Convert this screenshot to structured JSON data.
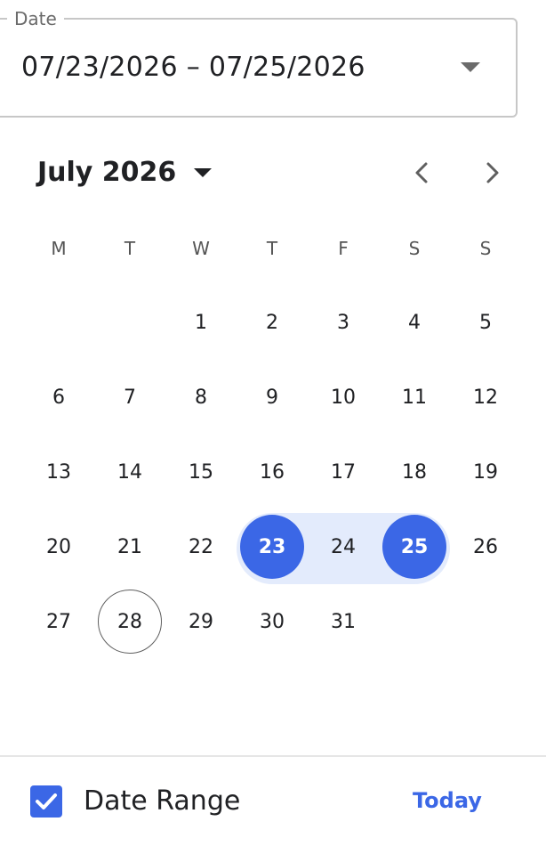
{
  "date_field": {
    "label": "Date",
    "value": "07/23/2026 – 07/25/2026",
    "dropdown_icon": "triangle-down-icon"
  },
  "calendar": {
    "month_title": "July 2026",
    "month_dropdown_icon": "caret-down-icon",
    "prev_icon": "chevron-left-icon",
    "next_icon": "chevron-right-icon",
    "weekdays": [
      "M",
      "T",
      "W",
      "T",
      "F",
      "S",
      "S"
    ],
    "weeks": [
      [
        "",
        "",
        "1",
        "2",
        "3",
        "4",
        "5"
      ],
      [
        "6",
        "7",
        "8",
        "9",
        "10",
        "11",
        "12"
      ],
      [
        "13",
        "14",
        "15",
        "16",
        "17",
        "18",
        "19"
      ],
      [
        "20",
        "21",
        "22",
        "23",
        "24",
        "25",
        "26"
      ],
      [
        "27",
        "28",
        "29",
        "30",
        "31",
        "",
        ""
      ]
    ],
    "range_start": "23",
    "range_end": "25",
    "today": "28",
    "colors": {
      "accent": "#3b67e6",
      "range_band": "#e3ebfc",
      "today_ring": "#5f5f5f"
    }
  },
  "footer": {
    "checkbox_checked": true,
    "checkbox_label": "Date Range",
    "today_button": "Today"
  }
}
